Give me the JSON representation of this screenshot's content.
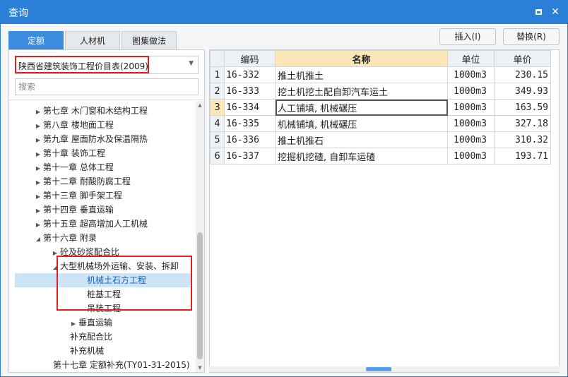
{
  "window": {
    "title": "查询",
    "maximize_icon": "maximize-icon",
    "close_icon": "close-icon"
  },
  "tabs": [
    {
      "label": "定额",
      "active": true
    },
    {
      "label": "人材机",
      "active": false
    },
    {
      "label": "图集做法",
      "active": false
    }
  ],
  "actions": {
    "insert": "插入(I)",
    "replace": "替换(R)"
  },
  "left": {
    "library_select": "陕西省建筑装饰工程价目表(2009)",
    "search_placeholder": "搜索",
    "tree": [
      {
        "label": "第七章 木门窗和木结构工程",
        "arrow": "▶"
      },
      {
        "label": "第八章 楼地面工程",
        "arrow": "▶"
      },
      {
        "label": "第九章 屋面防水及保温隔热",
        "arrow": "▶"
      },
      {
        "label": "第十章 装饰工程",
        "arrow": "▶"
      },
      {
        "label": "第十一章 总体工程",
        "arrow": "▶"
      },
      {
        "label": "第十二章 耐酸防腐工程",
        "arrow": "▶"
      },
      {
        "label": "第十三章 脚手架工程",
        "arrow": "▶"
      },
      {
        "label": "第十四章 垂直运输",
        "arrow": "▶"
      },
      {
        "label": "第十五章 超高增加人工机械",
        "arrow": "▶"
      },
      {
        "label": "第十六章 附录",
        "arrow": "◢"
      },
      {
        "label": "砼及砂浆配合比",
        "arrow": "▶"
      },
      {
        "label": "大型机械场外运输、安装、拆卸",
        "arrow": "◢"
      },
      {
        "label": "机械土石方工程",
        "arrow": ""
      },
      {
        "label": "桩基工程",
        "arrow": ""
      },
      {
        "label": "吊装工程",
        "arrow": ""
      },
      {
        "label": "垂直运输",
        "arrow": "▶"
      },
      {
        "label": "补充配合比",
        "arrow": ""
      },
      {
        "label": "补充机械",
        "arrow": ""
      },
      {
        "label": "第十七章 定额补充(TY01-31-2015)",
        "arrow": ""
      }
    ]
  },
  "table": {
    "headers": {
      "rowno": "",
      "code": "编码",
      "name": "名称",
      "unit": "单位",
      "price": "单价"
    },
    "rows": [
      {
        "no": "1",
        "code": "16-332",
        "name": "推土机推土",
        "unit": "1000m3",
        "price": "230.15"
      },
      {
        "no": "2",
        "code": "16-333",
        "name": "挖土机挖土配自卸汽车运土",
        "unit": "1000m3",
        "price": "349.93"
      },
      {
        "no": "3",
        "code": "16-334",
        "name": "人工铺填, 机械碾压",
        "unit": "1000m3",
        "price": "163.59"
      },
      {
        "no": "4",
        "code": "16-335",
        "name": "机械铺填, 机械碾压",
        "unit": "1000m3",
        "price": "327.18"
      },
      {
        "no": "5",
        "code": "16-336",
        "name": "推土机推石",
        "unit": "1000m3",
        "price": "310.32"
      },
      {
        "no": "6",
        "code": "16-337",
        "name": "挖掘机挖碴, 自卸车运碴",
        "unit": "1000m3",
        "price": "193.71"
      }
    ]
  },
  "colors": {
    "titlebar": "#2b7fd6",
    "active_tab": "#3c8de0",
    "highlight": "#fbe6b8",
    "selected_node": "#cce4f7",
    "annotation": "#e02020"
  }
}
